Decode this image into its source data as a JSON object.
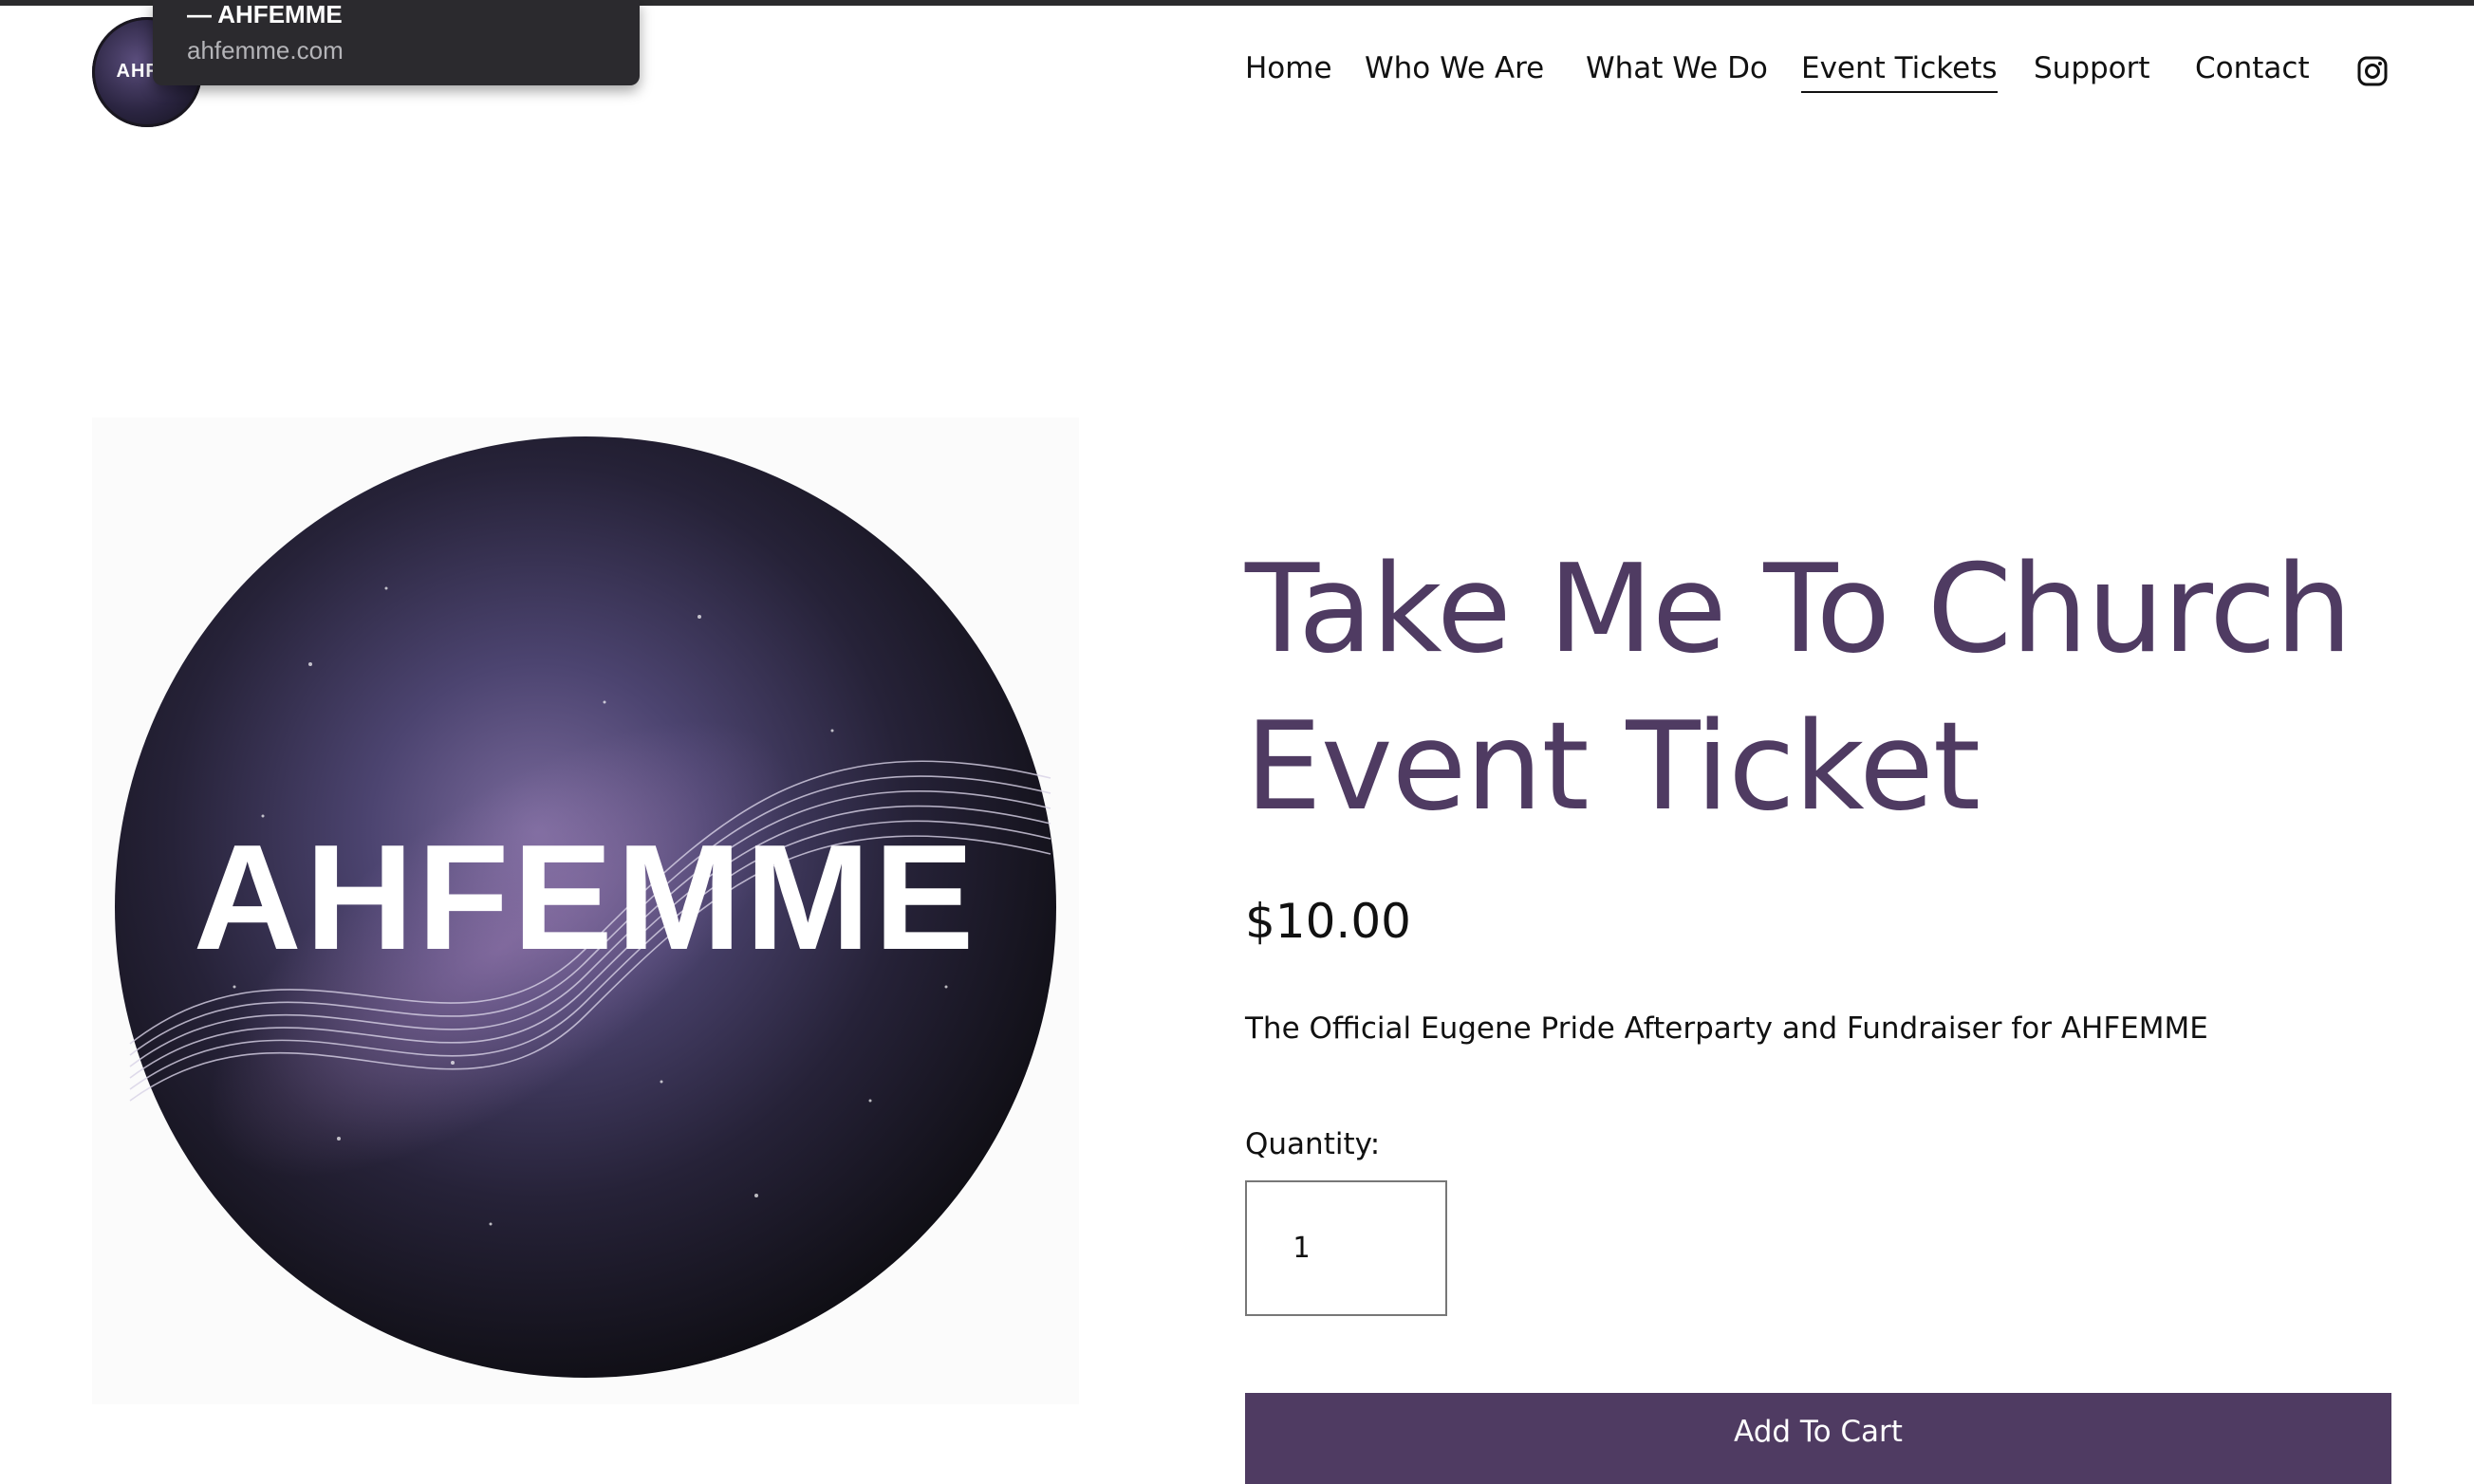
{
  "browser": {
    "tooltip_title": "— AHFEMME",
    "tooltip_url": "ahfemme.com"
  },
  "header": {
    "logo_text": "AHFEI",
    "nav": [
      {
        "label": "Home"
      },
      {
        "label": "Who We Are"
      },
      {
        "label": "What We Do"
      },
      {
        "label": "Event Tickets",
        "active": true
      },
      {
        "label": "Support"
      },
      {
        "label": "Contact"
      }
    ],
    "social_icon": "instagram-icon"
  },
  "product": {
    "image_text": "AHFEMME",
    "title_line1": "Take Me To Church",
    "title_line2": "Event Ticket",
    "price": "$10.00",
    "description": "The Official Eugene Pride Afterparty and Fundraiser for AHFEMME",
    "quantity_label": "Quantity:",
    "quantity_value": "1",
    "add_to_cart_label": "Add To Cart"
  },
  "colors": {
    "accent": "#4f3b62",
    "title": "#4f3b62",
    "topbar": "#2b2b2d"
  }
}
